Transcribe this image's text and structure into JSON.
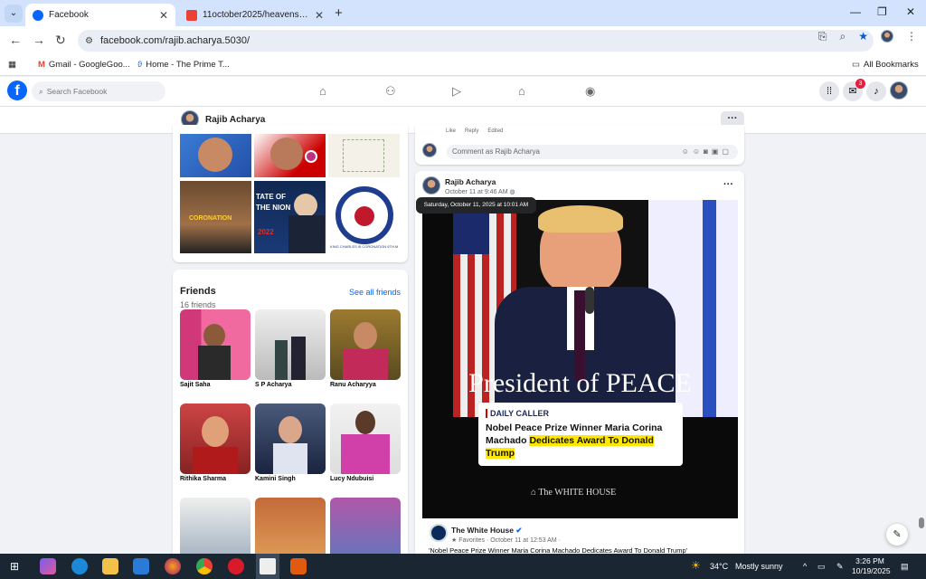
{
  "browser": {
    "tabs": [
      {
        "title": "Facebook",
        "active": true
      },
      {
        "title": "11october2025/heavensentallp",
        "active": false
      }
    ],
    "url": "facebook.com/rajib.acharya.5030/",
    "bookmarks": [
      {
        "label": "Gmail - GoogleGoo..."
      },
      {
        "label": "Home - The Prime T..."
      }
    ],
    "all_bookmarks": "All Bookmarks"
  },
  "fb": {
    "search_placeholder": "Search Facebook",
    "messenger_badge": "3",
    "profile_name": "Rajib Acharya"
  },
  "friends": {
    "title": "Friends",
    "count": "16 friends",
    "see_all": "See all friends",
    "list": [
      {
        "name": "Sajit Saha"
      },
      {
        "name": "S P Acharya"
      },
      {
        "name": "Ranu Acharyya"
      },
      {
        "name": "Rithika Sharma"
      },
      {
        "name": "Kamini Singh"
      },
      {
        "name": "Lucy Ndubuisi"
      }
    ]
  },
  "photos": {
    "coronation_label": "CORONATION",
    "sotu_label": "TATE OF THE NION",
    "sotu_year": "2022",
    "charles_text": "KING CHARLES III CORONATION 6TH MAY"
  },
  "comments": {
    "actions": [
      "Like",
      "Reply",
      "Edited"
    ],
    "placeholder": "Comment as Rajib Acharya"
  },
  "post": {
    "author": "Rajib Acharya",
    "time": "October 11 at 9:46 AM",
    "tooltip": "Saturday, October 11, 2025 at 10:01 AM",
    "image_title": "President of PEACE",
    "brand": "DAILY CALLER",
    "headline_plain": "Nobel Peace Prize Winner Maria Corina Machado ",
    "headline_highlight": "Dedicates Award To Donald Trump",
    "watermark": "The WHITE HOUSE",
    "shared_from": "The White House",
    "shared_meta": "Favorites · October 11 at 12:53 AM ·",
    "shared_caption": "'Nobel Peace Prize Winner Maria Corina Machado Dedicates Award To Donald Trump'"
  },
  "taskbar": {
    "weather": "34°C",
    "weather_desc": "Mostly sunny",
    "time": "3:26 PM",
    "date": "10/19/2025"
  },
  "colors": {
    "fb_blue": "#0866ff",
    "highlight": "#ffe800"
  }
}
